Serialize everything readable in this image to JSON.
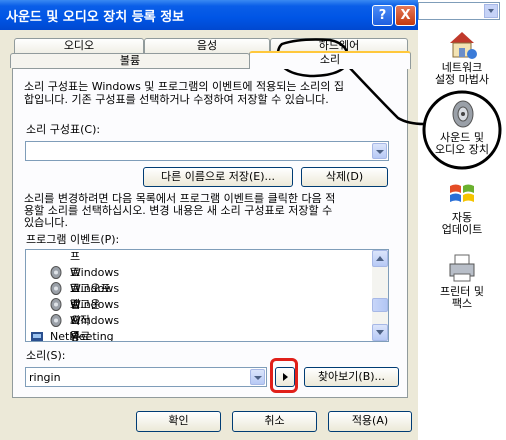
{
  "window": {
    "title": "사운드 및 오디오 장치 등록 정보",
    "help_label": "?",
    "close_label": "X"
  },
  "tabs": {
    "row_back": [
      "오디오",
      "음성",
      "하드웨어"
    ],
    "row_front": [
      "볼륨",
      "소리"
    ],
    "active": "소리"
  },
  "sounds": {
    "description": [
      "소리 구성표는 Windows 및 프로그램의 이벤트에 적용되는 소리의 집",
      "합입니다. 기존 구성표를 선택하거나 수정하여 저장할 수 있습니다."
    ],
    "scheme_label": "소리 구성표(C):",
    "scheme_value": "",
    "save_as_label": "다른 이름으로 저장(E)...",
    "delete_label": "삭제(D)",
    "instructions": [
      "소리를 변경하려면 다음 목록에서 프로그램 이벤트를 클릭한 다음 적",
      "용할 소리를 선택하십시오. 변경 내용은 새 소리 구성표로 저장할 수",
      "있습니다."
    ],
    "events_label": "프로그램 이벤트(P):",
    "events": [
      {
        "label": "프로그램 오류",
        "icon": "none"
      },
      {
        "label": "Windows 로그오프",
        "icon": "speaker"
      },
      {
        "label": "Windows 로그온",
        "icon": "speaker"
      },
      {
        "label": "Windows 시작",
        "icon": "speaker"
      },
      {
        "label": "Windows 종료",
        "icon": "speaker"
      },
      {
        "label": "NetMeeting",
        "icon": "app"
      }
    ],
    "sound_label": "소리(S):",
    "sound_value": "ringin",
    "browse_label": "찾아보기(B)..."
  },
  "footer": {
    "ok_label": "확인",
    "cancel_label": "취소",
    "apply_label": "적용(A)"
  },
  "desktop": {
    "icons": [
      {
        "name": "network-setup",
        "label1": "네트워크",
        "label2": "설정 마법사"
      },
      {
        "name": "sounds-audio",
        "label1": "사운드 및",
        "label2": "오디오 장치"
      },
      {
        "name": "auto-update",
        "label1": "자동",
        "label2": "업데이트"
      },
      {
        "name": "printers-faxes",
        "label1": "프린터 및",
        "label2": "팩스"
      }
    ]
  },
  "colors": {
    "titlebar": "#0055e5",
    "dialog_bg": "#ece9d8",
    "annotation": "#e0201a"
  }
}
